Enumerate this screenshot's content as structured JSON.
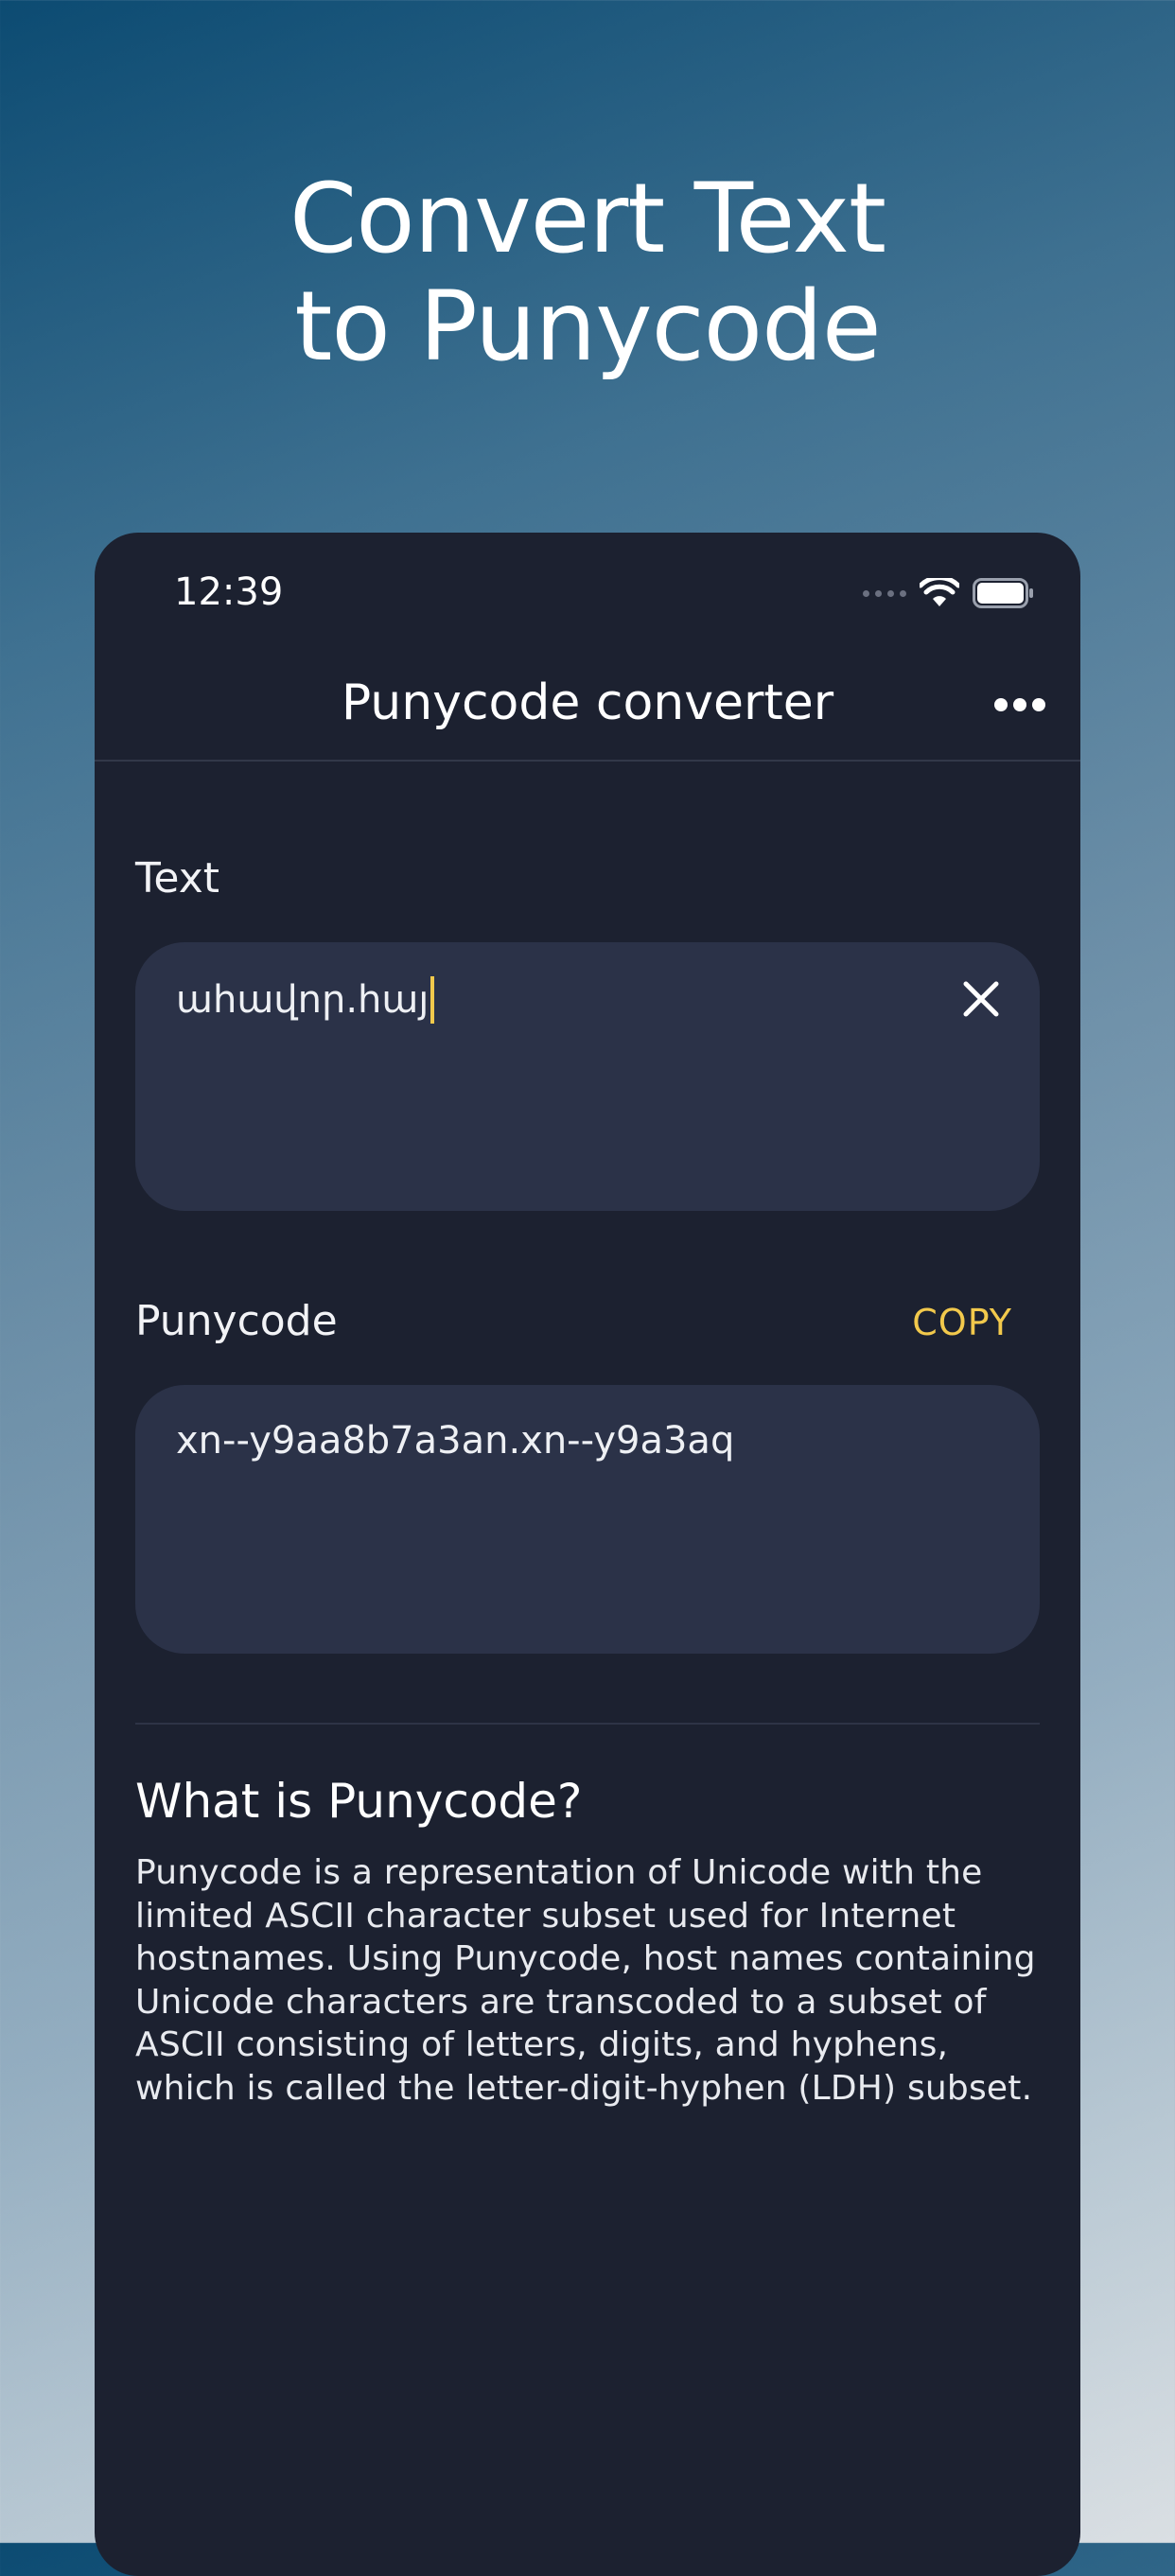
{
  "headline": {
    "line1": "Convert Text",
    "line2": "to Punycode"
  },
  "status_bar": {
    "time": "12:39",
    "icons": [
      "signal-icon",
      "wifi-icon",
      "battery-icon"
    ]
  },
  "nav": {
    "title": "Punycode converter",
    "more_icon": "more-icon"
  },
  "text_section": {
    "label": "Text",
    "value": "ահավոր.հայ",
    "clear_icon": "close-icon"
  },
  "punycode_section": {
    "label": "Punycode",
    "copy_label": "COPY",
    "value": "xn--y9aa8b7a3an.xn--y9a3aq"
  },
  "info": {
    "heading": "What is Punycode?",
    "body": "Punycode is a representation of Unicode with the limited ASCII character subset used for Internet hostnames. Using Punycode, host names containing Unicode characters are transcoded to a subset of ASCII consisting of letters, digits, and hyphens, which is called the letter-digit-hyphen (LDH) subset."
  },
  "colors": {
    "accent": "#f2c94c",
    "card_background": "#1c2130",
    "field_background": "#2b3248",
    "background_top": "#0c4b72",
    "background_bottom": "#dadfe3"
  }
}
